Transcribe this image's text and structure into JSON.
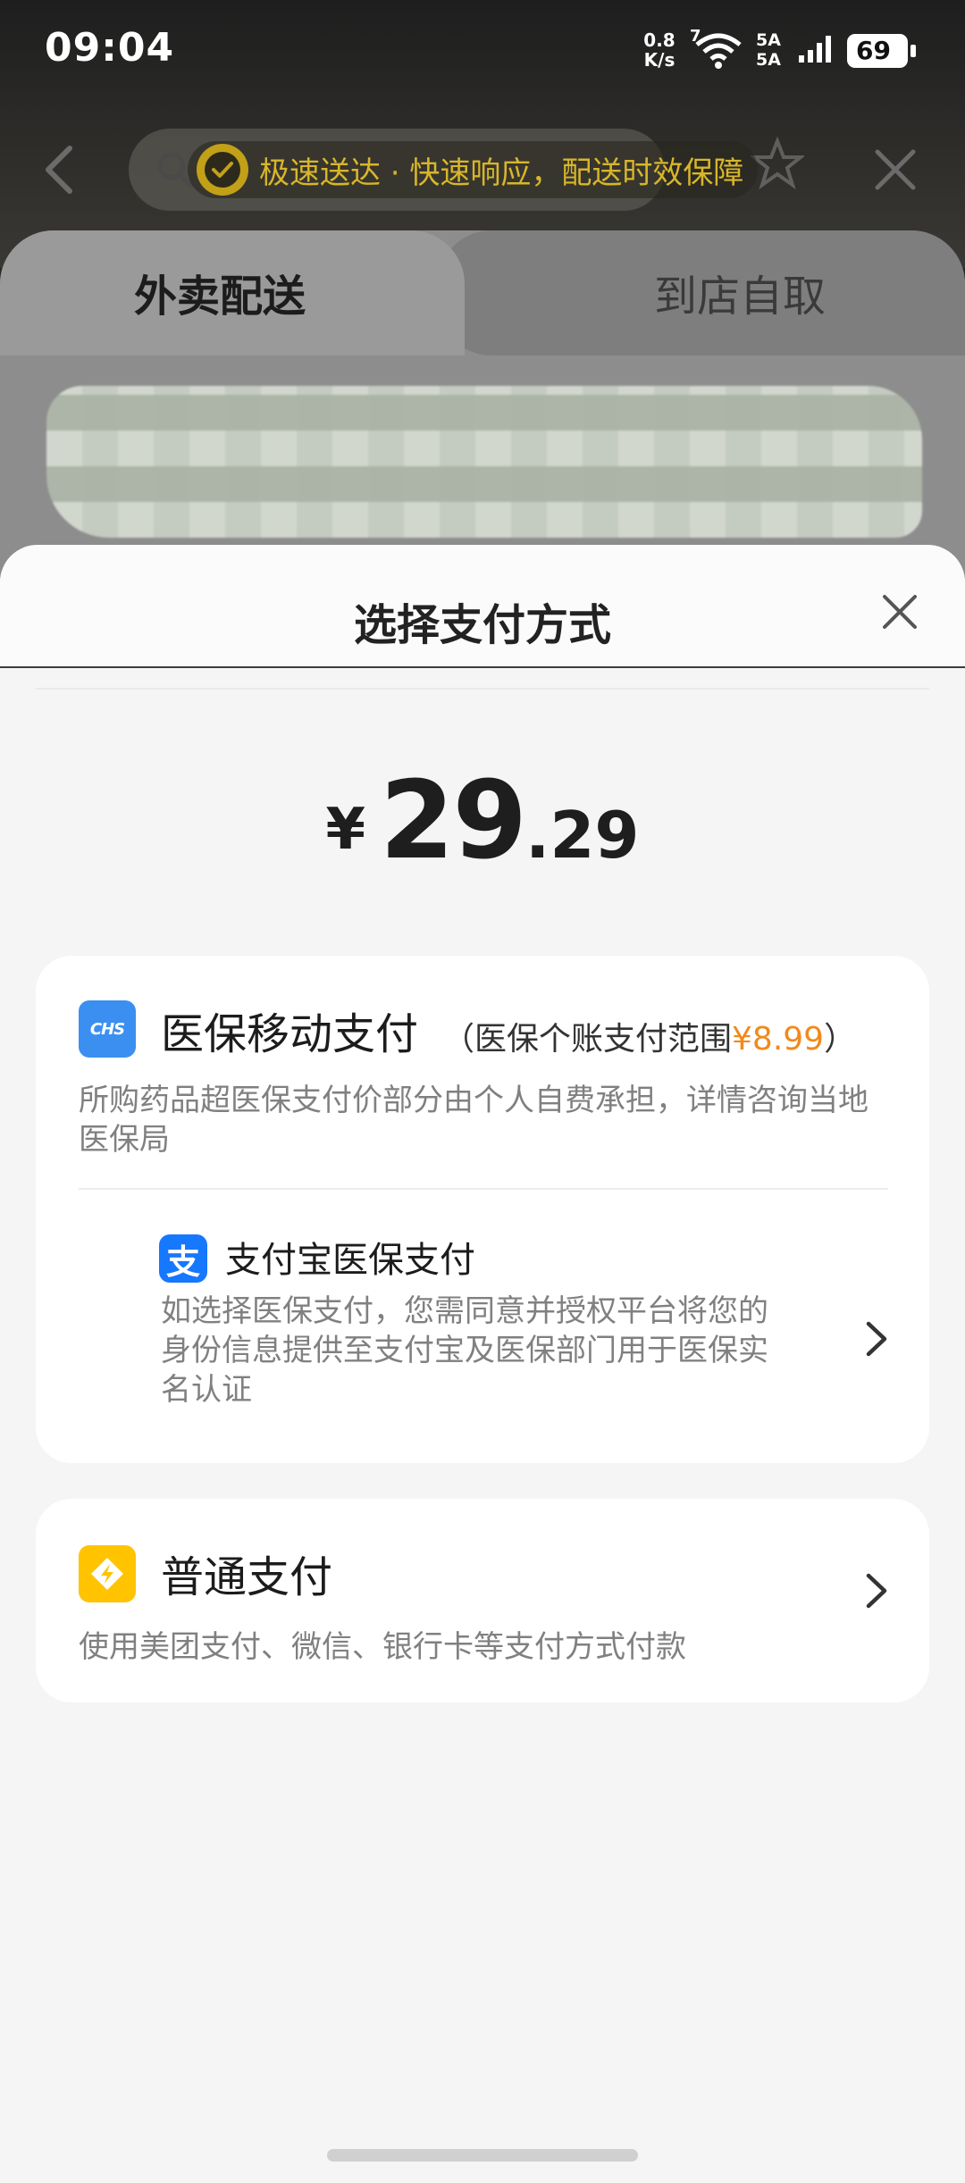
{
  "status_bar": {
    "time": "09:04",
    "net_speed_value": "0.8",
    "net_speed_unit": "K/s",
    "wifi_label": "7",
    "sim1": "5A",
    "sim2": "5A",
    "battery": "69"
  },
  "background_page": {
    "promo_text": "极速送达 · 快速响应，配送时效保障",
    "tab_delivery": "外卖配送",
    "tab_pickup": "到店自取"
  },
  "sheet": {
    "title": "选择支付方式",
    "amount": {
      "currency": "¥",
      "integer": "29",
      "decimal": ".29"
    },
    "medical_insurance": {
      "icon_text": "CHS",
      "title": "医保移动支付",
      "range_prefix": "（医保个账支付范围",
      "range_amount": "¥8.99",
      "range_suffix": "）",
      "description": "所购药品超医保支付价部分由个人自费承担，详情咨询当地医保局",
      "alipay_option": {
        "icon_text": "支",
        "title": "支付宝医保支付",
        "description": "如选择医保支付，您需同意并授权平台将您的身份信息提供至支付宝及医保部门用于医保实名认证"
      }
    },
    "normal_payment": {
      "title": "普通支付",
      "description": "使用美团支付、微信、银行卡等支付方式付款"
    }
  },
  "colors": {
    "accent_orange": "#f08a1c",
    "chs_blue": "#3b8ff0",
    "alipay_blue": "#1677ff",
    "meituan_yellow": "#ffc300"
  }
}
